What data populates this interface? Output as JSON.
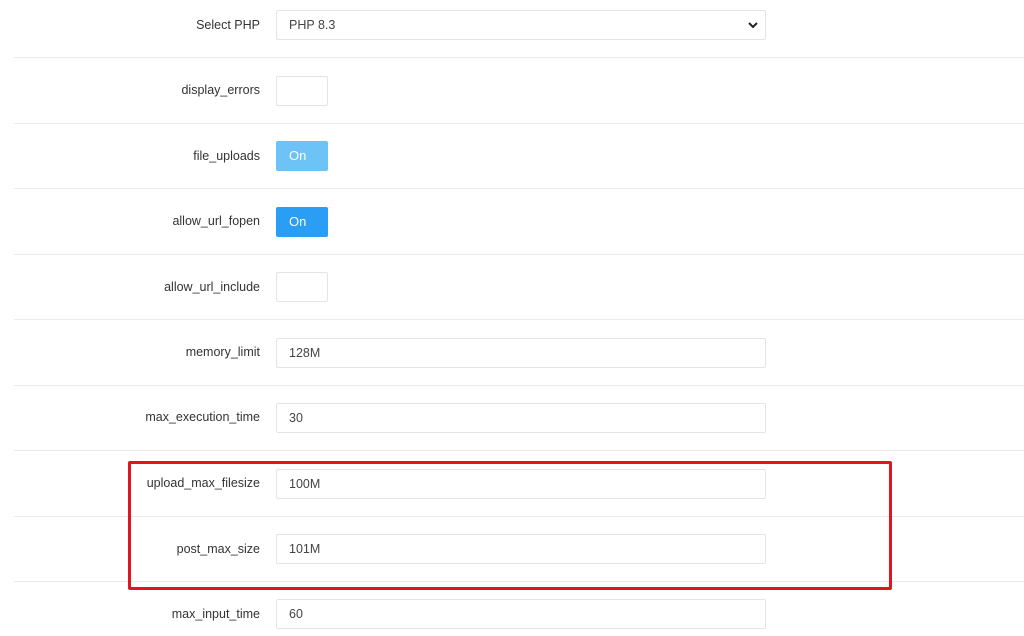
{
  "settings": {
    "select_php": {
      "label": "Select PHP",
      "value": "PHP 8.3"
    },
    "display_errors": {
      "label": "display_errors",
      "state": ""
    },
    "file_uploads": {
      "label": "file_uploads",
      "state": "On"
    },
    "allow_url_fopen": {
      "label": "allow_url_fopen",
      "state": "On"
    },
    "allow_url_include": {
      "label": "allow_url_include",
      "state": ""
    },
    "memory_limit": {
      "label": "memory_limit",
      "value": "128M"
    },
    "max_execution_time": {
      "label": "max_execution_time",
      "value": "30"
    },
    "upload_max_filesize": {
      "label": "upload_max_filesize",
      "value": "100M"
    },
    "post_max_size": {
      "label": "post_max_size",
      "value": "101M"
    },
    "max_input_time": {
      "label": "max_input_time",
      "value": "60"
    }
  },
  "colors": {
    "toggle_on_light": "#6ec3f6",
    "toggle_on": "#2a9df4",
    "highlight_border": "#e0161e"
  },
  "icons": {
    "select_chevron": "chevron-down-icon"
  }
}
